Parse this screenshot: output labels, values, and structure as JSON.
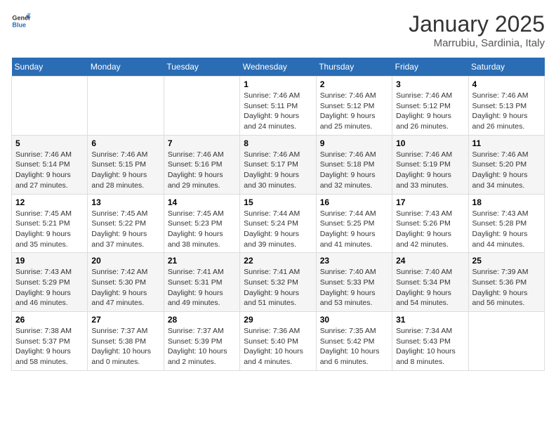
{
  "header": {
    "logo_general": "General",
    "logo_blue": "Blue",
    "month_title": "January 2025",
    "location": "Marrubiu, Sardinia, Italy"
  },
  "days_of_week": [
    "Sunday",
    "Monday",
    "Tuesday",
    "Wednesday",
    "Thursday",
    "Friday",
    "Saturday"
  ],
  "weeks": [
    {
      "days": [
        {
          "number": "",
          "info": ""
        },
        {
          "number": "",
          "info": ""
        },
        {
          "number": "",
          "info": ""
        },
        {
          "number": "1",
          "info": "Sunrise: 7:46 AM\nSunset: 5:11 PM\nDaylight: 9 hours and 24 minutes."
        },
        {
          "number": "2",
          "info": "Sunrise: 7:46 AM\nSunset: 5:12 PM\nDaylight: 9 hours and 25 minutes."
        },
        {
          "number": "3",
          "info": "Sunrise: 7:46 AM\nSunset: 5:12 PM\nDaylight: 9 hours and 26 minutes."
        },
        {
          "number": "4",
          "info": "Sunrise: 7:46 AM\nSunset: 5:13 PM\nDaylight: 9 hours and 26 minutes."
        }
      ]
    },
    {
      "days": [
        {
          "number": "5",
          "info": "Sunrise: 7:46 AM\nSunset: 5:14 PM\nDaylight: 9 hours and 27 minutes."
        },
        {
          "number": "6",
          "info": "Sunrise: 7:46 AM\nSunset: 5:15 PM\nDaylight: 9 hours and 28 minutes."
        },
        {
          "number": "7",
          "info": "Sunrise: 7:46 AM\nSunset: 5:16 PM\nDaylight: 9 hours and 29 minutes."
        },
        {
          "number": "8",
          "info": "Sunrise: 7:46 AM\nSunset: 5:17 PM\nDaylight: 9 hours and 30 minutes."
        },
        {
          "number": "9",
          "info": "Sunrise: 7:46 AM\nSunset: 5:18 PM\nDaylight: 9 hours and 32 minutes."
        },
        {
          "number": "10",
          "info": "Sunrise: 7:46 AM\nSunset: 5:19 PM\nDaylight: 9 hours and 33 minutes."
        },
        {
          "number": "11",
          "info": "Sunrise: 7:46 AM\nSunset: 5:20 PM\nDaylight: 9 hours and 34 minutes."
        }
      ]
    },
    {
      "days": [
        {
          "number": "12",
          "info": "Sunrise: 7:45 AM\nSunset: 5:21 PM\nDaylight: 9 hours and 35 minutes."
        },
        {
          "number": "13",
          "info": "Sunrise: 7:45 AM\nSunset: 5:22 PM\nDaylight: 9 hours and 37 minutes."
        },
        {
          "number": "14",
          "info": "Sunrise: 7:45 AM\nSunset: 5:23 PM\nDaylight: 9 hours and 38 minutes."
        },
        {
          "number": "15",
          "info": "Sunrise: 7:44 AM\nSunset: 5:24 PM\nDaylight: 9 hours and 39 minutes."
        },
        {
          "number": "16",
          "info": "Sunrise: 7:44 AM\nSunset: 5:25 PM\nDaylight: 9 hours and 41 minutes."
        },
        {
          "number": "17",
          "info": "Sunrise: 7:43 AM\nSunset: 5:26 PM\nDaylight: 9 hours and 42 minutes."
        },
        {
          "number": "18",
          "info": "Sunrise: 7:43 AM\nSunset: 5:28 PM\nDaylight: 9 hours and 44 minutes."
        }
      ]
    },
    {
      "days": [
        {
          "number": "19",
          "info": "Sunrise: 7:43 AM\nSunset: 5:29 PM\nDaylight: 9 hours and 46 minutes."
        },
        {
          "number": "20",
          "info": "Sunrise: 7:42 AM\nSunset: 5:30 PM\nDaylight: 9 hours and 47 minutes."
        },
        {
          "number": "21",
          "info": "Sunrise: 7:41 AM\nSunset: 5:31 PM\nDaylight: 9 hours and 49 minutes."
        },
        {
          "number": "22",
          "info": "Sunrise: 7:41 AM\nSunset: 5:32 PM\nDaylight: 9 hours and 51 minutes."
        },
        {
          "number": "23",
          "info": "Sunrise: 7:40 AM\nSunset: 5:33 PM\nDaylight: 9 hours and 53 minutes."
        },
        {
          "number": "24",
          "info": "Sunrise: 7:40 AM\nSunset: 5:34 PM\nDaylight: 9 hours and 54 minutes."
        },
        {
          "number": "25",
          "info": "Sunrise: 7:39 AM\nSunset: 5:36 PM\nDaylight: 9 hours and 56 minutes."
        }
      ]
    },
    {
      "days": [
        {
          "number": "26",
          "info": "Sunrise: 7:38 AM\nSunset: 5:37 PM\nDaylight: 9 hours and 58 minutes."
        },
        {
          "number": "27",
          "info": "Sunrise: 7:37 AM\nSunset: 5:38 PM\nDaylight: 10 hours and 0 minutes."
        },
        {
          "number": "28",
          "info": "Sunrise: 7:37 AM\nSunset: 5:39 PM\nDaylight: 10 hours and 2 minutes."
        },
        {
          "number": "29",
          "info": "Sunrise: 7:36 AM\nSunset: 5:40 PM\nDaylight: 10 hours and 4 minutes."
        },
        {
          "number": "30",
          "info": "Sunrise: 7:35 AM\nSunset: 5:42 PM\nDaylight: 10 hours and 6 minutes."
        },
        {
          "number": "31",
          "info": "Sunrise: 7:34 AM\nSunset: 5:43 PM\nDaylight: 10 hours and 8 minutes."
        },
        {
          "number": "",
          "info": ""
        }
      ]
    }
  ]
}
